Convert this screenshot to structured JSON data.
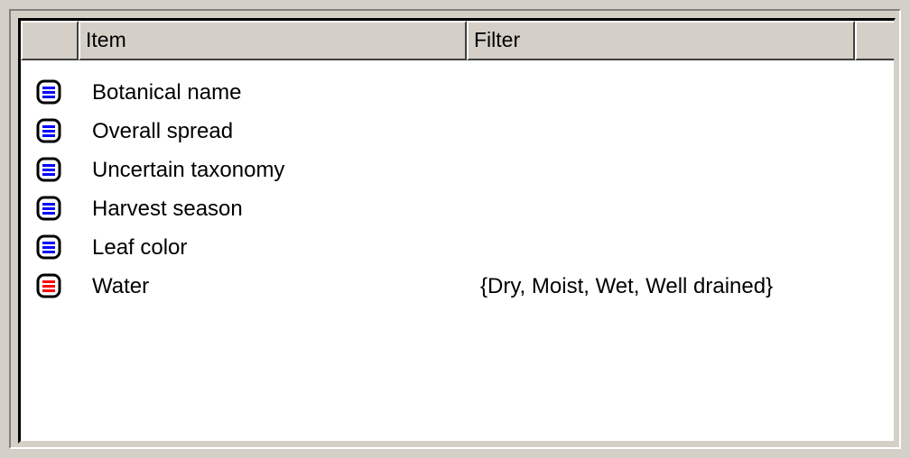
{
  "columns": {
    "item": "Item",
    "filter": "Filter"
  },
  "rows": [
    {
      "label": "Botanical name",
      "filter": "",
      "icon": "list-field-icon",
      "icon_color": "#0000ff"
    },
    {
      "label": "Overall spread",
      "filter": "",
      "icon": "list-field-icon",
      "icon_color": "#0000ff"
    },
    {
      "label": "Uncertain taxonomy",
      "filter": "",
      "icon": "list-field-icon",
      "icon_color": "#0000ff"
    },
    {
      "label": "Harvest season",
      "filter": "",
      "icon": "list-field-icon",
      "icon_color": "#0000ff"
    },
    {
      "label": "Leaf color",
      "filter": "",
      "icon": "list-field-icon",
      "icon_color": "#0000ff"
    },
    {
      "label": "Water",
      "filter": "{Dry, Moist, Wet, Well drained}",
      "icon": "filtered-field-icon",
      "icon_color": "#ff0000"
    }
  ],
  "colors": {
    "face": "#d4d0c8",
    "window": "#ffffff"
  }
}
